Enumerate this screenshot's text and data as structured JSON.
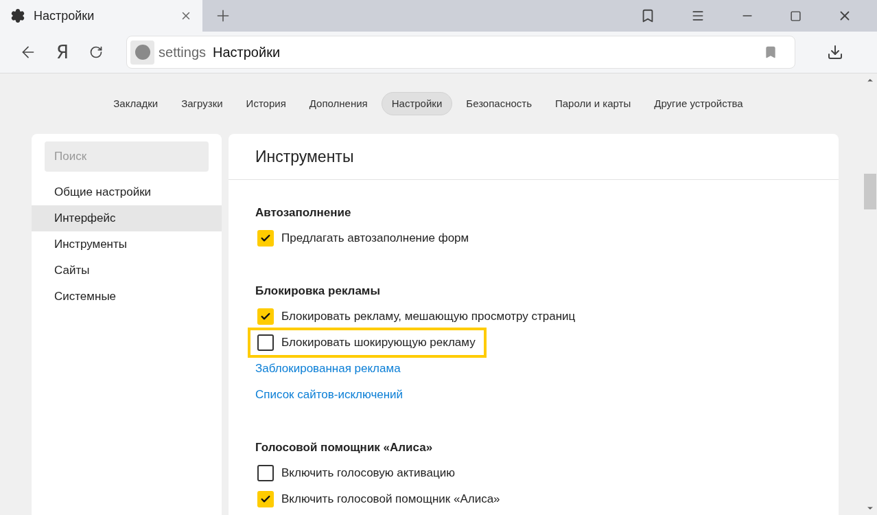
{
  "tab": {
    "title": "Настройки"
  },
  "toolbar": {
    "logo_letter": "Я",
    "address_prefix": "settings",
    "address_title": "Настройки"
  },
  "nav": [
    {
      "label": "Закладки",
      "selected": false
    },
    {
      "label": "Загрузки",
      "selected": false
    },
    {
      "label": "История",
      "selected": false
    },
    {
      "label": "Дополнения",
      "selected": false
    },
    {
      "label": "Настройки",
      "selected": true
    },
    {
      "label": "Безопасность",
      "selected": false
    },
    {
      "label": "Пароли и карты",
      "selected": false
    },
    {
      "label": "Другие устройства",
      "selected": false
    }
  ],
  "sidebar": {
    "search": {
      "placeholder": "Поиск"
    },
    "items": [
      {
        "label": "Общие настройки",
        "selected": false
      },
      {
        "label": "Интерфейс",
        "selected": true
      },
      {
        "label": "Инструменты",
        "selected": false
      },
      {
        "label": "Сайты",
        "selected": false
      },
      {
        "label": "Системные",
        "selected": false
      }
    ]
  },
  "content": {
    "title": "Инструменты",
    "sections": [
      {
        "title": "Автозаполнение",
        "items": [
          {
            "kind": "checkbox",
            "label": "Предлагать автозаполнение форм",
            "checked": true,
            "highlighted": false
          }
        ]
      },
      {
        "title": "Блокировка рекламы",
        "items": [
          {
            "kind": "checkbox",
            "label": "Блокировать рекламу, мешающую просмотру страниц",
            "checked": true,
            "highlighted": false
          },
          {
            "kind": "checkbox",
            "label": "Блокировать шокирующую рекламу",
            "checked": false,
            "highlighted": true
          },
          {
            "kind": "link",
            "label": "Заблокированная реклама"
          },
          {
            "kind": "link",
            "label": "Список сайтов-исключений"
          }
        ]
      },
      {
        "title": "Голосовой помощник «Алиса»",
        "items": [
          {
            "kind": "checkbox",
            "label": "Включить голосовую активацию",
            "checked": false,
            "highlighted": false
          },
          {
            "kind": "checkbox",
            "label": "Включить голосовой помощник «Алиса»",
            "checked": true,
            "highlighted": false
          }
        ]
      }
    ]
  }
}
